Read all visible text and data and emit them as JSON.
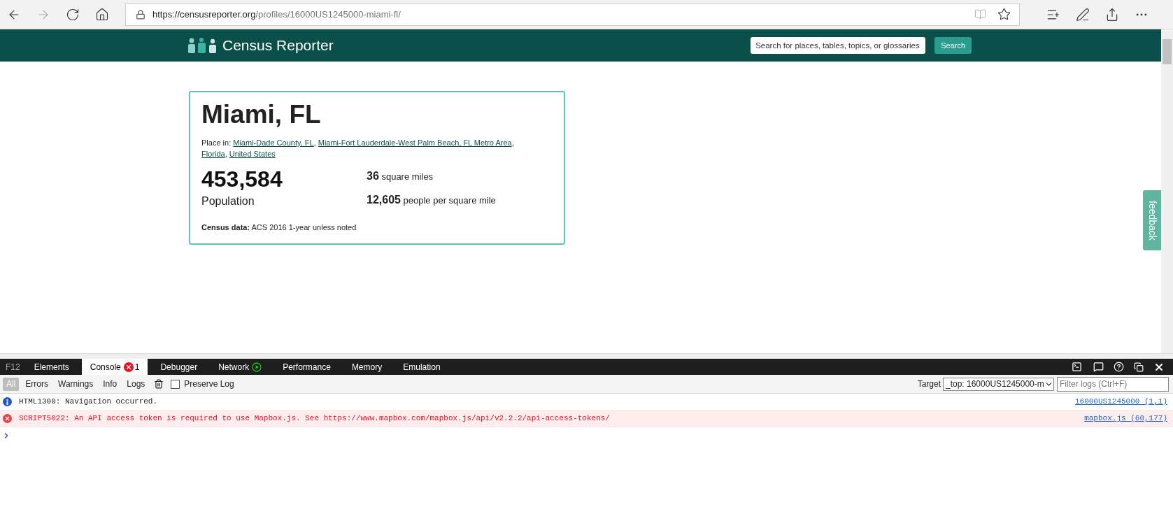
{
  "browser": {
    "url_host": "https://censusreporter.org",
    "url_path": "/profiles/16000US1245000-miami-fl/"
  },
  "header": {
    "logo_text": "Census Reporter",
    "search_placeholder": "Search for places, tables, topics, or glossaries",
    "search_button": "Search"
  },
  "profile": {
    "title": "Miami, FL",
    "place_in_label": "Place in:",
    "parents": [
      {
        "name": "Miami-Dade County, FL",
        "suffix": ","
      },
      {
        "name": "Miami-Fort Lauderdale-West Palm Beach, FL Metro Area",
        "suffix": ","
      },
      {
        "name": "Florida",
        "suffix": ","
      },
      {
        "name": "United States"
      }
    ],
    "population": {
      "value": "453,584",
      "label": "Population"
    },
    "stats": [
      {
        "value": "36",
        "label": "square miles"
      },
      {
        "value": "12,605",
        "label": "people per square mile"
      }
    ],
    "census_data": {
      "label": "Census data:",
      "value": "ACS 2016 1-year unless noted"
    }
  },
  "feedback": "feedback",
  "devtools": {
    "f12_label": "F12",
    "tabs": [
      {
        "label": "Elements",
        "selected": false,
        "kind": "plain"
      },
      {
        "label": "Console",
        "selected": true,
        "kind": "errors",
        "badge": "1"
      },
      {
        "label": "Debugger",
        "selected": false,
        "kind": "plain"
      },
      {
        "label": "Network",
        "selected": false,
        "kind": "recording"
      },
      {
        "label": "Performance",
        "selected": false,
        "kind": "plain"
      },
      {
        "label": "Memory",
        "selected": false,
        "kind": "plain"
      },
      {
        "label": "Emulation",
        "selected": false,
        "kind": "plain"
      }
    ],
    "filters": [
      {
        "label": "All",
        "selected": true
      },
      {
        "label": "Errors",
        "selected": false
      },
      {
        "label": "Warnings",
        "selected": false
      },
      {
        "label": "Info",
        "selected": false
      },
      {
        "label": "Logs",
        "selected": false
      }
    ],
    "preserve_log": {
      "label": "Preserve Log",
      "checked": false
    },
    "target": {
      "label": "Target",
      "value": "_top: 16000US1245000-m"
    },
    "filter_placeholder": "Filter logs (Ctrl+F)",
    "messages": [
      {
        "kind": "info",
        "text": "HTML1300: Navigation occurred.",
        "source": "16000US1245000 (1,1)"
      },
      {
        "kind": "error",
        "text": "SCRIPT5022: An API access token is required to use Mapbox.js. See https://www.mapbox.com/mapbox.js/api/v2.2.2/api-access-tokens/",
        "source": "mapbox.js (60,177)"
      }
    ]
  }
}
